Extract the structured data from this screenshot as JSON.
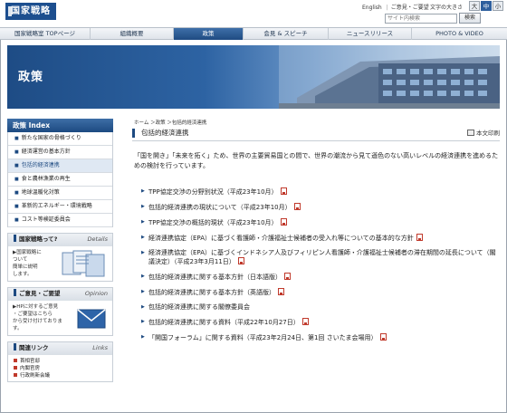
{
  "header": {
    "logo_text": "国家戦略",
    "util_links": [
      "English",
      "ご意見・ご要望"
    ],
    "font_size_label": "文字の大きさ",
    "font_sizes": [
      "大",
      "中",
      "小"
    ],
    "search_placeholder": "サイト内検索",
    "search_button": "検索"
  },
  "nav": {
    "items": [
      "国家戦略室 TOPページ",
      "組織概要",
      "政策",
      "会見 & スピーチ",
      "ニュースリリース",
      "PHOTO & VIDEO"
    ]
  },
  "banner": {
    "title": "政策"
  },
  "sidebar": {
    "index_title": "政策 Index",
    "index_items": [
      "新たな国家の骨格づくり",
      "経済運営の基本方針",
      "包括的経済連携",
      "食と農林漁業の再生",
      "地球温暖化対策",
      "革新的エネルギー・環境戦略",
      "コスト等検証委員会"
    ],
    "about_title": "国家戦略って?",
    "about_sub": "Details",
    "about_text": [
      "▶国家戦略に",
      "ついて",
      "簡単に説明",
      "します。"
    ],
    "opinion_title": "ご意見・ご要望",
    "opinion_sub": "Opinion",
    "opinion_text": [
      "▶HPに対するご意見",
      "・ご要望はこちら",
      "から受け付けておりま",
      "す。"
    ],
    "links_title": "関連リンク",
    "links_sub": "Links",
    "links": [
      "首相官邸",
      "内閣官房",
      "行政刷新会議"
    ]
  },
  "main": {
    "breadcrumb": "ホーム ＞政策 ＞包括的経済連携",
    "title": "包括的経済連携",
    "print_label": "本文印刷",
    "lead": "「国を開き」「未来を拓く」ため、世界の主要貿易国との間で、世界の潮流から見て遜色のない高いレベルの経済連携を進めるための検討を行っています。",
    "items": [
      "TPP協定交渉の分野別状況（平成23年10月）",
      "包括的経済連携の現状について（平成23年10月）",
      "TPP協定交渉の概括的現状（平成23年10月）",
      "経済連携協定（EPA）に基づく看護師・介護福祉士候補者の受入れ等についての基本的な方針",
      "経済連携協定（EPA）に基づくインドネシア人及びフィリピン人看護師・介護福祉士候補者の滞在期間の延長について（閣議決定）（平成23年3月11日）",
      "包括的経済連携に関する基本方針（日本語版）",
      "包括的経済連携に関する基本方針（英語版）",
      "包括的経済連携に関する閣僚委員会",
      "包括的経済連携に関する資料（平成22年10月27日）",
      "「開国フォーラム」に関する資料（平成23年2月24日、第1回 さいたま会場用）"
    ]
  }
}
